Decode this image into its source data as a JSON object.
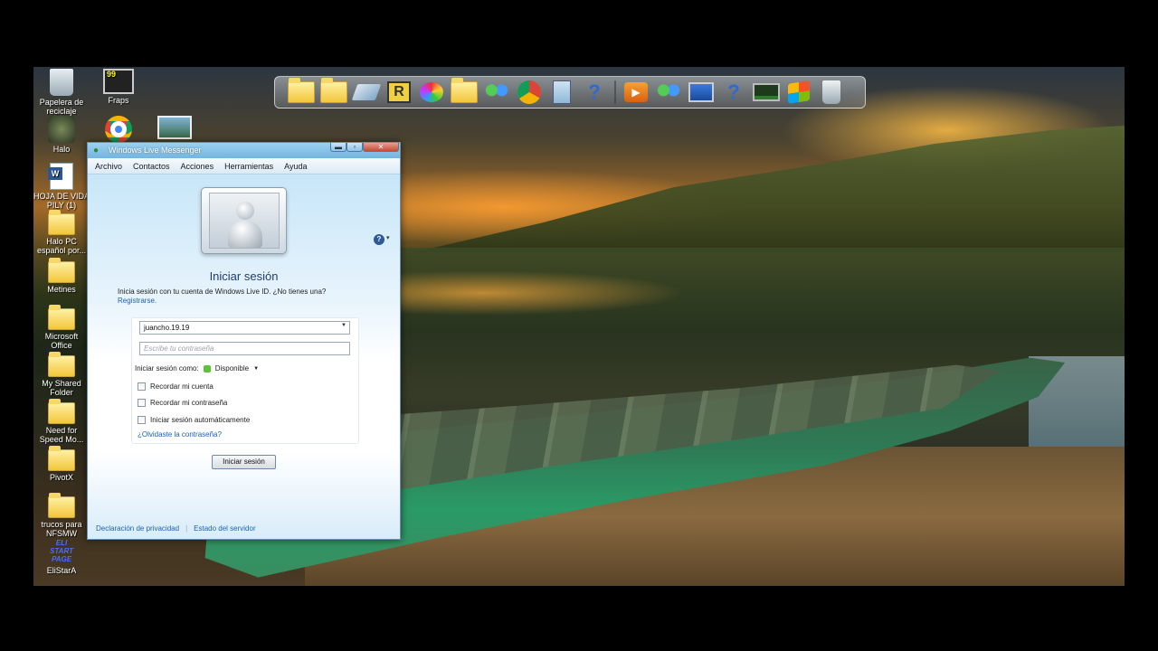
{
  "desktop_icons": [
    {
      "label": "Papelera de reciclaje",
      "icon": "recycle-bin-icon"
    },
    {
      "label": "Fraps",
      "icon": "fraps-icon",
      "badge": "99"
    },
    {
      "label": "Halo",
      "icon": "halo-icon"
    },
    {
      "label": "HOJA DE VIDA PILY (1)",
      "icon": "word-document-icon"
    },
    {
      "label": "Halo PC español por...",
      "icon": "folder-icon"
    },
    {
      "label": "Metines",
      "icon": "folder-icon"
    },
    {
      "label": "Microsoft Office",
      "icon": "folder-icon"
    },
    {
      "label": "My Shared Folder",
      "icon": "folder-icon"
    },
    {
      "label": "Need for Speed Mo...",
      "icon": "folder-icon"
    },
    {
      "label": "PivotX",
      "icon": "folder-icon"
    },
    {
      "label": "trucos para NFSMW",
      "icon": "folder-icon"
    },
    {
      "label": "EliStarA",
      "icon": "elistara-start-page-icon",
      "badge": "ELI START PAGE"
    }
  ],
  "dock": {
    "items": [
      "folder-icon",
      "folder-icon",
      "eraser-icon",
      "r-icon",
      "paint-palette-icon",
      "folder-icon",
      "messenger-icon",
      "chrome-icon",
      "calculator-icon",
      "help-icon",
      "separator",
      "media-player-icon",
      "messenger-icon",
      "monitor-icon",
      "help-icon",
      "screen-icon",
      "windows-flag-icon",
      "recycle-bin-icon"
    ]
  },
  "window": {
    "title": "Windows Live Messenger",
    "menu": [
      "Archivo",
      "Contactos",
      "Acciones",
      "Herramientas",
      "Ayuda"
    ]
  },
  "signin": {
    "heading": "Iniciar sesión",
    "description": "Inicia sesión con tu cuenta de Windows Live ID. ¿No tienes una?",
    "register_link": "Registrarse.",
    "email_value": "juancho.19.19",
    "password_placeholder": "Escribe tu contraseña",
    "status_label": "Iniciar sesión como:",
    "status_value": "Disponible",
    "remember_account": "Recordar mi cuenta",
    "remember_password": "Recordar mi contraseña",
    "auto_signin": "Iniciar sesión automáticamente",
    "forgot_link": "¿Olvidaste la contraseña?",
    "signin_button": "Iniciar sesión"
  },
  "footer": {
    "privacy": "Declaración de privacidad",
    "server_status": "Estado del servidor"
  }
}
